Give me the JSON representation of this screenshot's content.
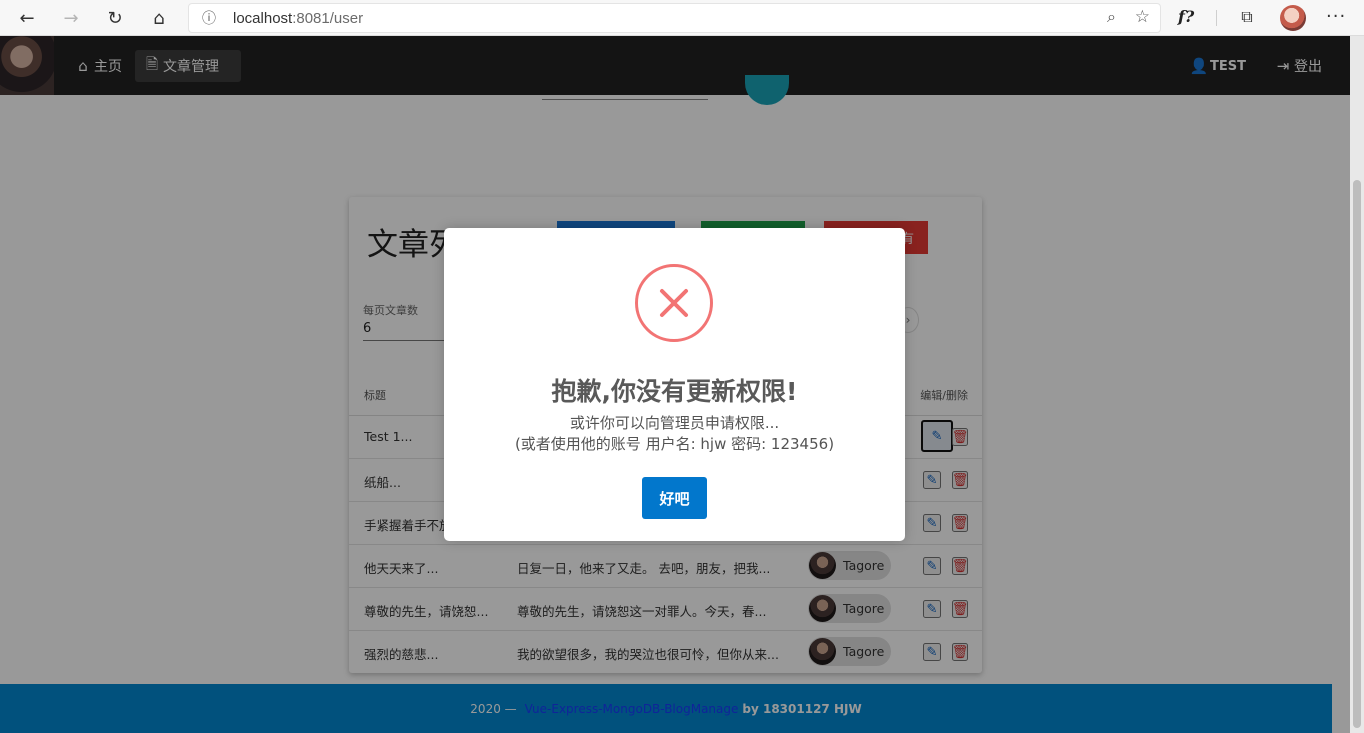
{
  "browser": {
    "url_host": "localhost",
    "url_rest": ":8081/user",
    "back_glyph": "←",
    "forward_glyph": "→",
    "refresh_glyph": "↻",
    "home_glyph": "⌂",
    "info_glyph": "ⓘ",
    "zoom_glyph": "⌕",
    "star_glyph": "☆",
    "fx_label": "f?",
    "collections_glyph": "⧉",
    "more_glyph": "···"
  },
  "nav": {
    "home_label": "主页",
    "articles_label": "文章管理",
    "user_label": "TEST",
    "logout_label": "登出",
    "home_icon": "⌂",
    "articles_icon": "🗎",
    "user_icon": "👤",
    "logout_icon": "⇥"
  },
  "card": {
    "title": "文章列表",
    "red_button_label": "有",
    "per_page_label": "每页文章数",
    "per_page_value": "6",
    "col_title": "标题",
    "col_ops": "编辑/删除",
    "edit_icon": "✎",
    "delete_icon": "🗑",
    "rows": [
      {
        "title": "Test 1...",
        "summary": "",
        "author": ""
      },
      {
        "title": "纸船...",
        "summary": "",
        "author": ""
      },
      {
        "title": "手紧握着手不放...",
        "summary": "",
        "author": ""
      },
      {
        "title": "他天天来了...",
        "summary": "日复一日，他来了又走。 去吧，朋友，把我...",
        "author": "Tagore"
      },
      {
        "title": "尊敬的先生，请饶恕...",
        "summary": "尊敬的先生，请饶恕这一对罪人。今天，春...",
        "author": "Tagore"
      },
      {
        "title": "强烈的慈悲...",
        "summary": "我的欲望很多，我的哭泣也很可怜，但你从来...",
        "author": "Tagore"
      }
    ]
  },
  "footer": {
    "year": "2020 —",
    "link": "Vue-Express-MongoDB-BlogManage",
    "by": "by 18301127 HJW"
  },
  "modal": {
    "title": "抱歉,你没有更新权限!",
    "line1": "或许你可以向管理员申请权限...",
    "line2": "(或者使用他的账号 用户名: hjw 密码: 123456)",
    "ok_label": "好吧"
  },
  "colors": {
    "nav_bg": "#222222",
    "footer_bg": "#0288d1",
    "error_red": "#f27474",
    "ok_button": "#0277cc"
  }
}
